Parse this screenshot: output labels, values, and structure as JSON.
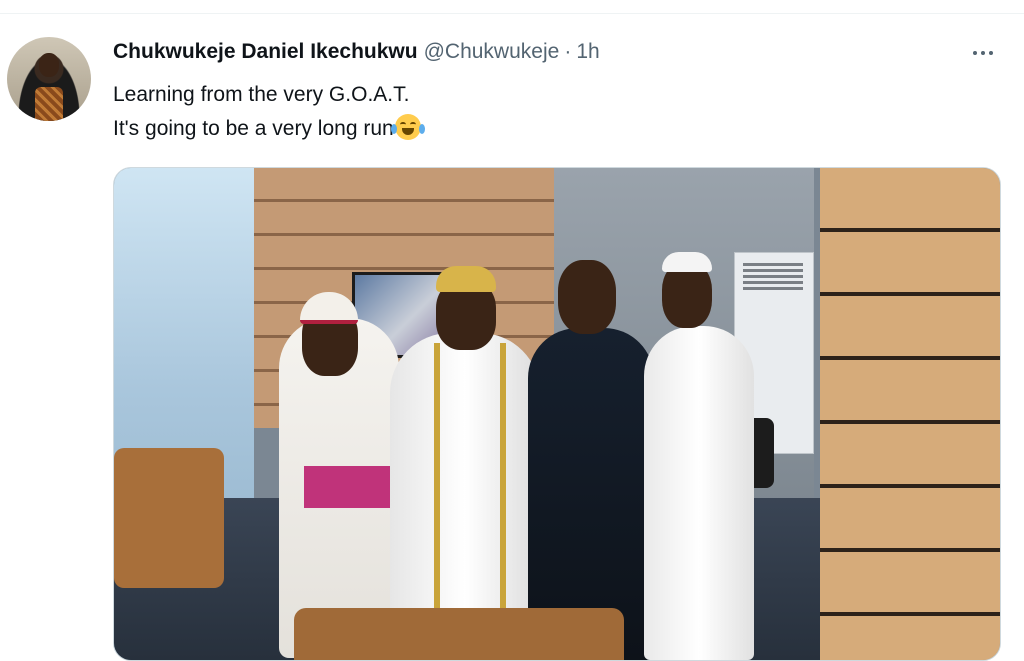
{
  "tweet": {
    "author_name": "Chukwukeje Daniel Ikechukwu",
    "handle": "@Chukwukeje",
    "separator": "·",
    "time": "1h",
    "text_line1": "Learning from the very G.O.A.T.",
    "text_line2": "It's going to be a very long run",
    "emoji": "face-with-tears-of-joy",
    "more_icon": "more-horizontal-icon"
  },
  "colors": {
    "text_primary": "#0f1419",
    "text_secondary": "#536471",
    "border": "#cfd9de"
  }
}
